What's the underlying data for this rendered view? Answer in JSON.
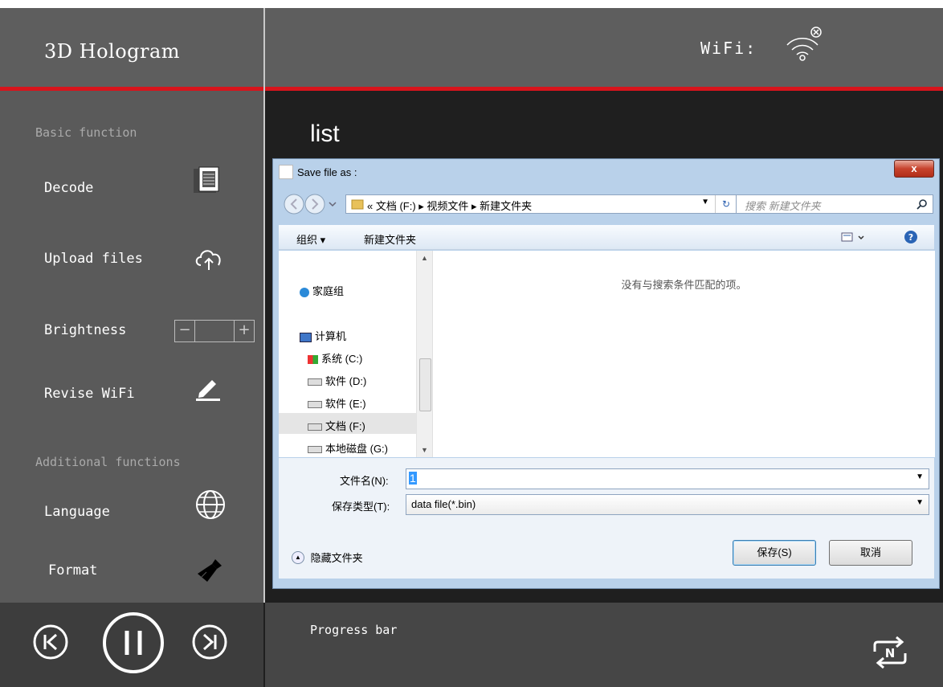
{
  "app": {
    "title": "3D  Hologram"
  },
  "header": {
    "wifi_label": "WiFi:",
    "wifi_icon": "wifi-disconnected-icon"
  },
  "sidebar": {
    "basic_heading": "Basic function",
    "additional_heading": "Additional functions",
    "items": [
      {
        "label": "Decode",
        "icon": "document-icon"
      },
      {
        "label": "Upload files",
        "icon": "cloud-upload-icon"
      },
      {
        "label": "Brightness",
        "icon": "brightness-stepper"
      },
      {
        "label": "Revise WiFi",
        "icon": "pencil-icon"
      },
      {
        "label": "Language",
        "icon": "globe-icon"
      },
      {
        "label": "Format",
        "icon": "broom-icon"
      }
    ],
    "stepper": {
      "minus": "−",
      "plus": "+"
    }
  },
  "main": {
    "list_title": "list",
    "progress_label": "Progress bar"
  },
  "player": {
    "prev": "previous-icon",
    "pause": "pause-icon",
    "next": "next-icon",
    "loop": "loop-n-icon",
    "loop_text": "N"
  },
  "dialog": {
    "title": "Save file as :",
    "close_label": "x",
    "breadcrumb": "«  文档 (F:)  ▸  视频文件  ▸  新建文件夹",
    "search_placeholder": "搜索 新建文件夹",
    "toolbar": {
      "organize": "组织 ▾",
      "new_folder": "新建文件夹"
    },
    "nav": [
      {
        "label": "家庭组"
      },
      {
        "label": "计算机"
      },
      {
        "label": "系统 (C:)"
      },
      {
        "label": "软件 (D:)"
      },
      {
        "label": "软件 (E:)"
      },
      {
        "label": "文档 (F:)"
      },
      {
        "label": "本地磁盘 (G:)"
      }
    ],
    "empty_message": "没有与搜索条件匹配的项。",
    "filename_label": "文件名(N):",
    "filename_value": "1",
    "filetype_label": "保存类型(T):",
    "filetype_value": "data file(*.bin)",
    "hide_folders": "隐藏文件夹",
    "save_button": "保存(S)",
    "cancel_button": "取消"
  }
}
